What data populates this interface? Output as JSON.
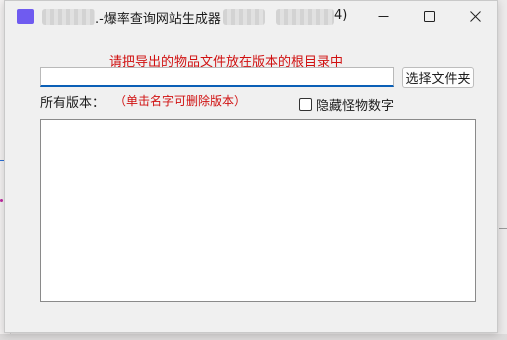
{
  "window": {
    "title_suffix": ".-爆率查询网站生成器（",
    "title_end": "4)",
    "controls": {
      "minimize": "minimize-icon",
      "maximize": "maximize-icon",
      "close": "close-icon"
    }
  },
  "main": {
    "hint": "请把导出的物品文件放在版本的根目录中",
    "path_input": {
      "value": "",
      "placeholder": ""
    },
    "choose_button": "选择文件夹",
    "versions_label": "所有版本：",
    "delete_hint": "（单击名字可删除版本）",
    "hide_monster_numbers": {
      "label": "隐藏怪物数字",
      "checked": false
    },
    "version_list": []
  },
  "colors": {
    "hint_red": "#d01010",
    "app_icon": "#6f5bf0",
    "input_focus": "#0a5fb6"
  }
}
